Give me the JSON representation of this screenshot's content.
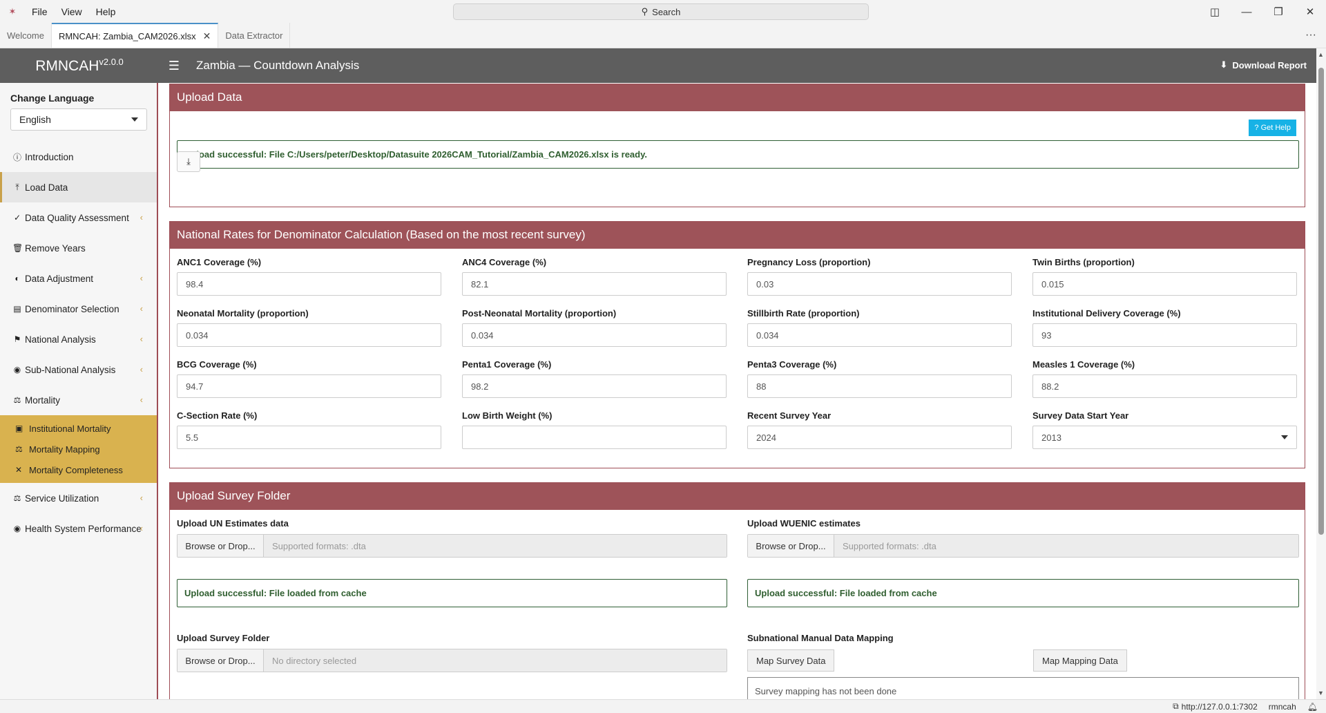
{
  "titlebar": {
    "menu": [
      "File",
      "View",
      "Help"
    ],
    "search_label": "Search"
  },
  "tabs": [
    {
      "label": "Welcome",
      "active": false
    },
    {
      "label": "RMNCAH: Zambia_CAM2026.xlsx",
      "active": true
    },
    {
      "label": "Data Extractor",
      "active": false
    }
  ],
  "header": {
    "brand": "RMNCAH",
    "version": "v2.0.0",
    "title": "Zambia — Countdown Analysis",
    "download_label": "Download Report"
  },
  "sidebar": {
    "language_label": "Change Language",
    "language_value": "English",
    "items": [
      {
        "label": "Introduction",
        "icon": "info-icon"
      },
      {
        "label": "Load Data",
        "icon": "upload-icon",
        "active": true
      },
      {
        "label": "Data Quality Assessment",
        "icon": "check-circle-icon",
        "expandable": true
      },
      {
        "label": "Remove Years",
        "icon": "trash-icon"
      },
      {
        "label": "Data Adjustment",
        "icon": "adjust-icon",
        "expandable": true
      },
      {
        "label": "Denominator Selection",
        "icon": "list-icon",
        "expandable": true
      },
      {
        "label": "National Analysis",
        "icon": "flag-icon",
        "expandable": true
      },
      {
        "label": "Sub-National Analysis",
        "icon": "globe-icon",
        "expandable": true
      },
      {
        "label": "Mortality",
        "icon": "balance-icon",
        "expandable": true
      }
    ],
    "subitems": [
      {
        "label": "Institutional Mortality",
        "icon": "hospital-icon"
      },
      {
        "label": "Mortality Mapping",
        "icon": "map-icon"
      },
      {
        "label": "Mortality Completeness",
        "icon": "person-icon"
      }
    ],
    "items_after": [
      {
        "label": "Service Utilization",
        "icon": "balance-icon",
        "expandable": true
      },
      {
        "label": "Health System Performance",
        "icon": "globe-icon",
        "expandable": true
      }
    ]
  },
  "upload_data": {
    "title": "Upload Data",
    "help_label": "? Get Help",
    "success_message": "Upload successful: File C:/Users/peter/Desktop/Datasuite 2026CAM_Tutorial/Zambia_CAM2026.xlsx is ready."
  },
  "national_rates": {
    "title": "National Rates for Denominator Calculation (Based on the most recent survey)",
    "fields": [
      {
        "label": "ANC1 Coverage (%)",
        "value": "98.4"
      },
      {
        "label": "ANC4 Coverage (%)",
        "value": "82.1"
      },
      {
        "label": "Pregnancy Loss (proportion)",
        "value": "0.03"
      },
      {
        "label": "Twin Births (proportion)",
        "value": "0.015"
      },
      {
        "label": "Neonatal Mortality (proportion)",
        "value": "0.034"
      },
      {
        "label": "Post-Neonatal Mortality (proportion)",
        "value": "0.034"
      },
      {
        "label": "Stillbirth Rate (proportion)",
        "value": "0.034"
      },
      {
        "label": "Institutional Delivery Coverage (%)",
        "value": "93"
      },
      {
        "label": "BCG Coverage (%)",
        "value": "94.7"
      },
      {
        "label": "Penta1 Coverage (%)",
        "value": "98.2"
      },
      {
        "label": "Penta3 Coverage (%)",
        "value": "88"
      },
      {
        "label": "Measles 1 Coverage (%)",
        "value": "88.2"
      },
      {
        "label": "C-Section Rate (%)",
        "value": "5.5"
      },
      {
        "label": "Low Birth Weight (%)",
        "value": ""
      },
      {
        "label": "Recent Survey Year",
        "value": "2024"
      },
      {
        "label": "Survey Data Start Year",
        "value": "2013",
        "select": true
      }
    ]
  },
  "survey_folder": {
    "title": "Upload Survey Folder",
    "un_label": "Upload UN Estimates data",
    "wuenic_label": "Upload WUENIC estimates",
    "browse_label": "Browse or Drop...",
    "supported_formats": "Supported formats: .dta",
    "cache_success": "Upload successful: File loaded from cache",
    "folder_label": "Upload Survey Folder",
    "no_directory": "No directory selected",
    "mapping_label": "Subnational Manual Data Mapping",
    "map_survey_label": "Map Survey Data",
    "map_mapping_label": "Map Mapping Data",
    "mapping_status": "Survey mapping has not been done"
  },
  "statusbar": {
    "url": "http://127.0.0.1:7302",
    "app": "rmncah"
  }
}
